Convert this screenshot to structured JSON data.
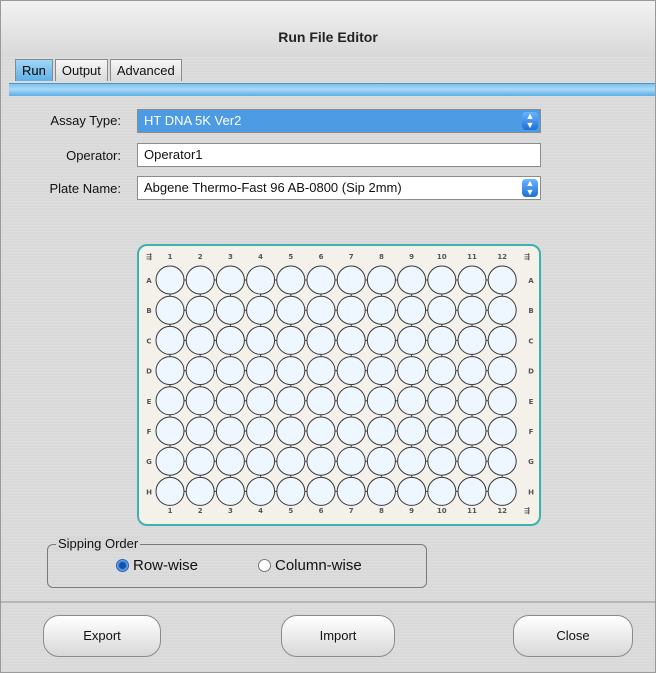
{
  "window": {
    "title": "Run File Editor"
  },
  "tabs": [
    {
      "label": "Run"
    },
    {
      "label": "Output"
    },
    {
      "label": "Advanced"
    }
  ],
  "form": {
    "assay_type_label": "Assay Type:",
    "assay_type_value": "HT DNA 5K Ver2",
    "operator_label": "Operator:",
    "operator_value": "Operator1",
    "plate_name_label": "Plate Name:",
    "plate_name_value": "Abgene Thermo-Fast 96 AB-0800 (Sip 2mm)"
  },
  "plate": {
    "columns": [
      "1",
      "2",
      "3",
      "4",
      "5",
      "6",
      "7",
      "8",
      "9",
      "10",
      "11",
      "12"
    ],
    "rows": [
      "A",
      "B",
      "C",
      "D",
      "E",
      "F",
      "G",
      "H"
    ]
  },
  "sipping": {
    "legend": "Sipping Order",
    "row_label": "Row-wise",
    "column_label": "Column-wise",
    "selected": "Row-wise"
  },
  "buttons": {
    "export": "Export",
    "import": "Import",
    "close": "Close"
  },
  "colors": {
    "accent_tab": "#5fb0e6",
    "plate_border": "#3fb0b0",
    "selected_field": "#4d9be2"
  }
}
